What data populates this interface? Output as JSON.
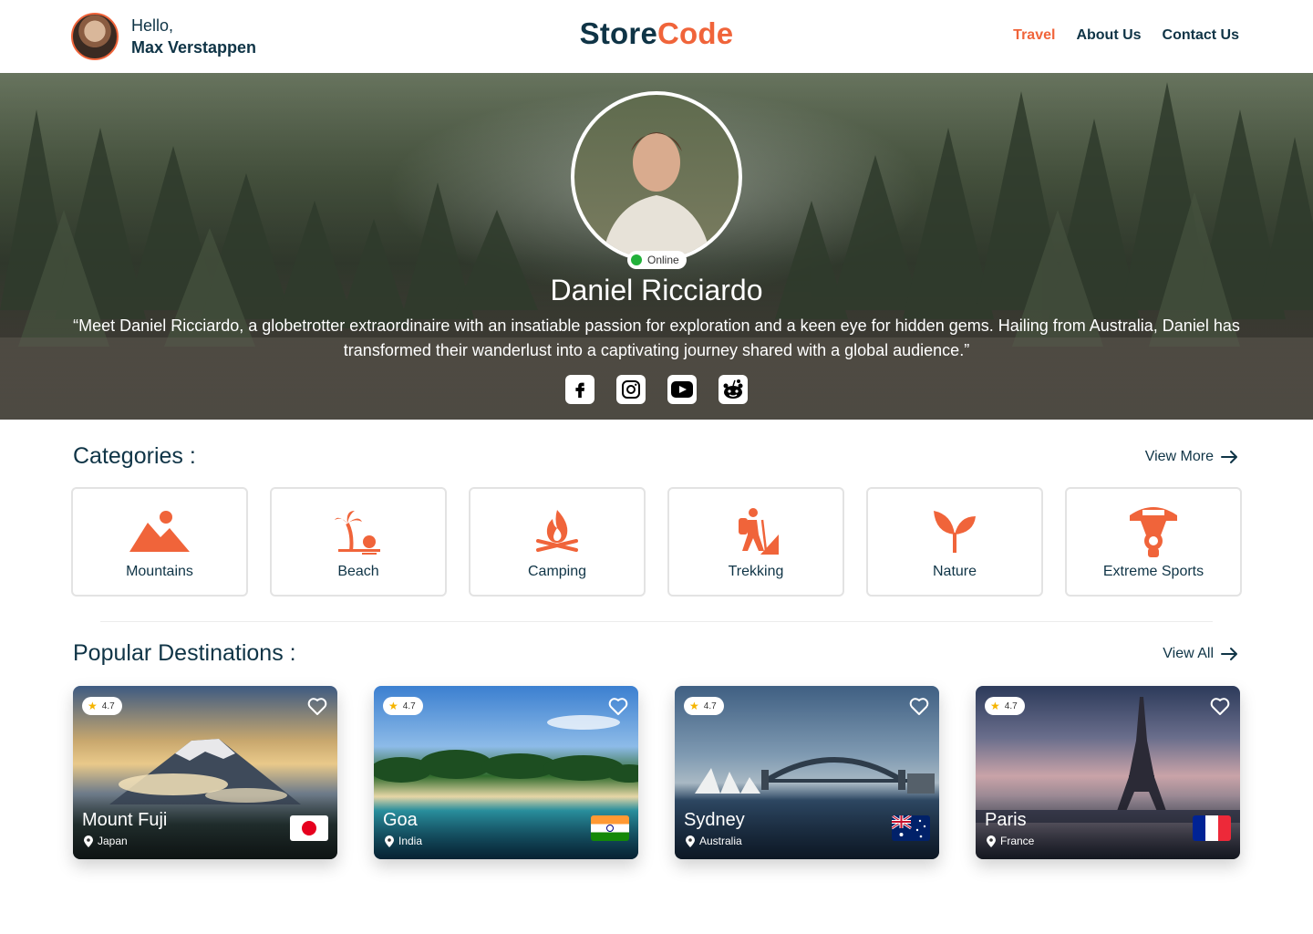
{
  "header": {
    "greeting": "Hello,",
    "user_name": "Max Verstappen",
    "logo_part1": "Store",
    "logo_part2": "Code",
    "nav": [
      "Travel",
      "About Us",
      "Contact Us"
    ]
  },
  "hero": {
    "status": "Online",
    "name": "Daniel Ricciardo",
    "quote": "“Meet Daniel Ricciardo, a globetrotter extraordinaire with an insatiable passion for exploration and a keen eye for hidden gems. Hailing from Australia, Daniel has transformed their wanderlust into a captivating journey shared with a global audience.”",
    "socials": [
      "facebook-icon",
      "instagram-icon",
      "youtube-icon",
      "reddit-icon"
    ]
  },
  "categories": {
    "title": "Categories :",
    "more": "View More",
    "items": [
      {
        "label": "Mountains",
        "icon": "mountain-icon"
      },
      {
        "label": "Beach",
        "icon": "beach-icon"
      },
      {
        "label": "Camping",
        "icon": "campfire-icon"
      },
      {
        "label": "Trekking",
        "icon": "hiker-icon"
      },
      {
        "label": "Nature",
        "icon": "sprout-icon"
      },
      {
        "label": "Extreme Sports",
        "icon": "parachute-icon"
      }
    ]
  },
  "destinations": {
    "title": "Popular Destinations :",
    "more": "View All",
    "items": [
      {
        "name": "Mount Fuji",
        "location": "Japan",
        "rating": "4.7"
      },
      {
        "name": "Goa",
        "location": "India",
        "rating": "4.7"
      },
      {
        "name": "Sydney",
        "location": "Australia",
        "rating": "4.7"
      },
      {
        "name": "Paris",
        "location": "France",
        "rating": "4.7"
      }
    ]
  },
  "colors": {
    "primary": "#0f3446",
    "accent": "#f0643a"
  }
}
